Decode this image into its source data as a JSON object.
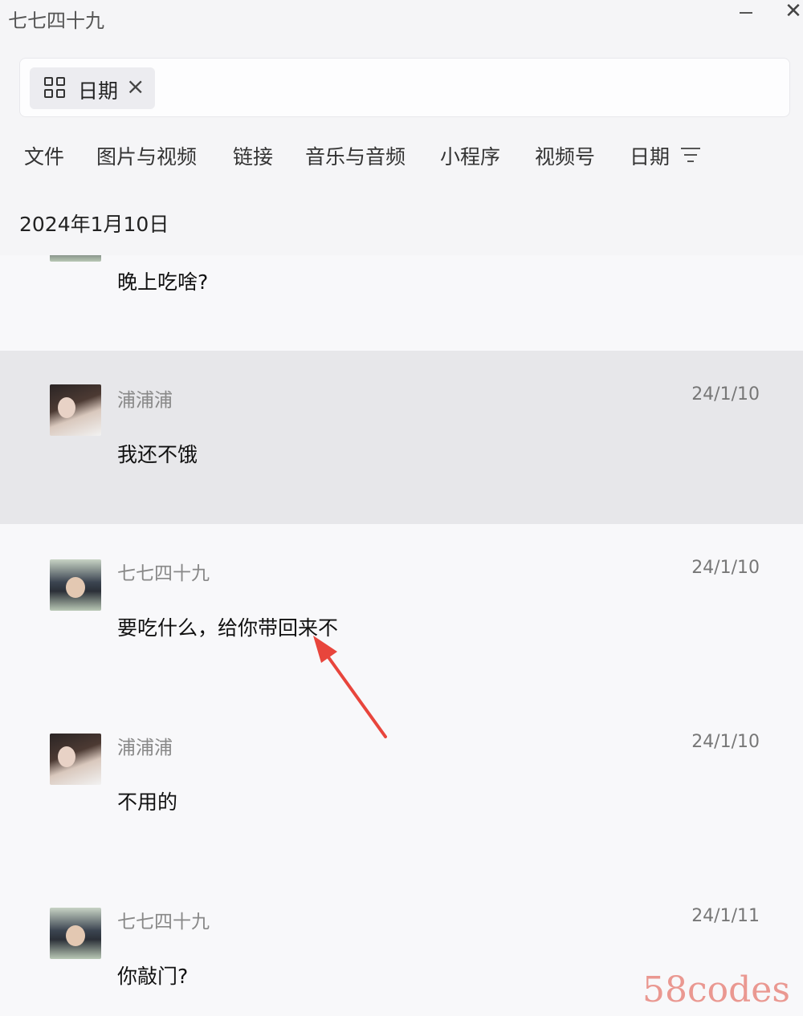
{
  "window": {
    "title": "七七四十九",
    "close_glyph": "✕"
  },
  "search": {
    "filter_chip_label": "日期",
    "filter_chip_close": "×"
  },
  "tabs": [
    {
      "label": "文件"
    },
    {
      "label": "图片与视频"
    },
    {
      "label": "链接"
    },
    {
      "label": "音乐与音频"
    },
    {
      "label": "小程序"
    },
    {
      "label": "视频号"
    },
    {
      "label": "日期"
    }
  ],
  "date_heading": "2024年1月10日",
  "messages": [
    {
      "sender": "",
      "time": "",
      "text": "晚上吃啥?",
      "avatar": "man-avatar",
      "selected": false
    },
    {
      "sender": "浦浦浦",
      "time": "24/1/10",
      "text": "我还不饿",
      "avatar": "woman-avatar",
      "selected": true
    },
    {
      "sender": "七七四十九",
      "time": "24/1/10",
      "text": "要吃什么，给你带回来不",
      "avatar": "man-avatar",
      "selected": false
    },
    {
      "sender": "浦浦浦",
      "time": "24/1/10",
      "text": "不用的",
      "avatar": "woman-avatar",
      "selected": false
    },
    {
      "sender": "七七四十九",
      "time": "24/1/11",
      "text": "你敲门?",
      "avatar": "man-avatar",
      "selected": false
    }
  ],
  "annotation": {
    "color": "#e8453c"
  },
  "watermark": "58codes"
}
